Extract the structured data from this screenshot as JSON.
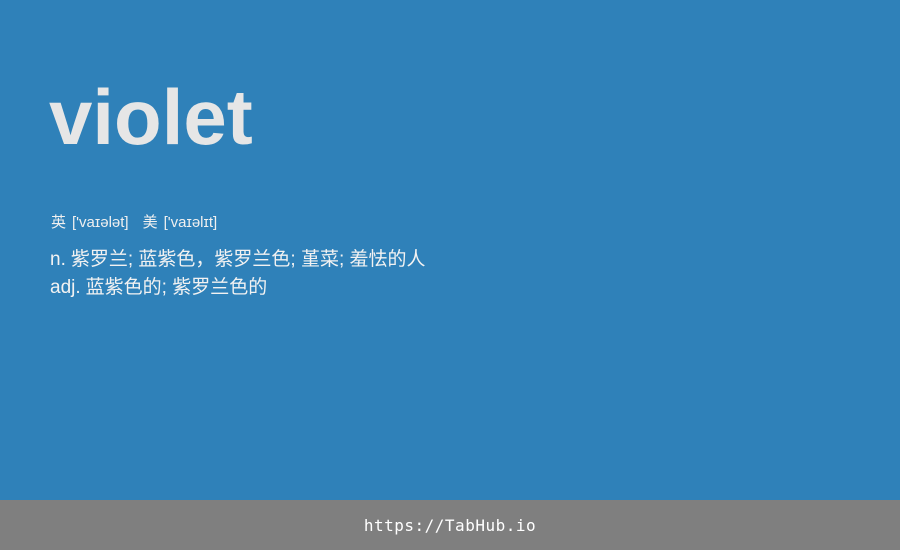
{
  "entry": {
    "word": "violet",
    "phonetics": [
      {
        "label": "英",
        "ipa": "['vaɪələt]"
      },
      {
        "label": "美",
        "ipa": "['vaɪəlɪt]"
      }
    ],
    "definitions": [
      {
        "pos": "n.",
        "meaning": "紫罗兰; 蓝紫色，紫罗兰色; 堇菜; 羞怯的人"
      },
      {
        "pos": "adj.",
        "meaning": "蓝紫色的; 紫罗兰色的"
      }
    ]
  },
  "footer": {
    "link_text": "https://TabHub.io"
  },
  "colors": {
    "background": "#2f81b9",
    "word": "#e6e6e6",
    "text": "#f2f2f2",
    "footer_bg": "#7f7f7f",
    "footer_text": "#ffffff"
  }
}
